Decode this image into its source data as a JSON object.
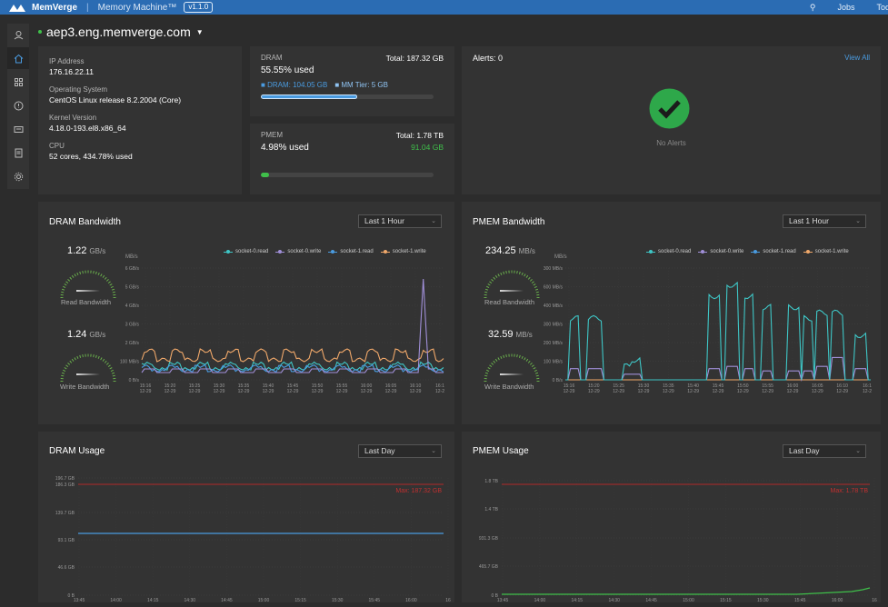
{
  "topbar": {
    "brand": "MemVerge",
    "product": "Memory Machine™",
    "version": "v1.1.0",
    "jobs": "Jobs",
    "tools": "Tool"
  },
  "host": {
    "name": "aep3.eng.memverge.com"
  },
  "sysinfo": [
    {
      "label": "IP Address",
      "value": "176.16.22.11"
    },
    {
      "label": "Operating System",
      "value": "CentOS Linux release 8.2.2004 (Core)"
    },
    {
      "label": "Kernel Version",
      "value": "4.18.0-193.el8.x86_64"
    },
    {
      "label": "CPU",
      "value": "52 cores, 434.78% used"
    }
  ],
  "dram": {
    "label": "DRAM",
    "total": "Total: 187.32 GB",
    "used": "55.55% used",
    "dram_chip": "DRAM: 104.05 GB",
    "mm_tier": "MM Tier: 5 GB",
    "fill_pct": 55.55
  },
  "pmem": {
    "label": "PMEM",
    "total": "Total: 1.78 TB",
    "used": "4.98% used",
    "amount": "91.04 GB",
    "fill_pct": 4.98
  },
  "alerts": {
    "title": "Alerts: 0",
    "view_all": "View All",
    "empty": "No Alerts"
  },
  "dram_bw": {
    "title": "DRAM Bandwidth",
    "range": "Last 1 Hour",
    "read_value": "1.22",
    "read_unit": "GB/s",
    "read_label": "Read Bandwidth",
    "write_value": "1.24",
    "write_unit": "GB/s",
    "write_label": "Write Bandwidth",
    "y_unit": "MB/s",
    "y_ticks": [
      "6 GB/s",
      "5 GB/s",
      "4 GB/s",
      "3 GB/s",
      "2 GB/s",
      "100 MB/s",
      "0 B/s"
    ]
  },
  "pmem_bw": {
    "title": "PMEM Bandwidth",
    "range": "Last 1 Hour",
    "read_value": "234.25",
    "read_unit": "MB/s",
    "read_label": "Read Bandwidth",
    "write_value": "32.59",
    "write_unit": "MB/s",
    "write_label": "Write Bandwidth",
    "y_unit": "MB/s",
    "y_ticks": [
      "300 MB/s",
      "600 MB/s",
      "400 MB/s",
      "300 MB/s",
      "200 MB/s",
      "100 MB/s",
      "0 B/s"
    ]
  },
  "legend": [
    {
      "name": "socket-0.read",
      "color": "#3ec6c6"
    },
    {
      "name": "socket-0.write",
      "color": "#a08fd8"
    },
    {
      "name": "socket-1.read",
      "color": "#4a9be0"
    },
    {
      "name": "socket-1.write",
      "color": "#f0a86a"
    }
  ],
  "bw_xticks": [
    "15:16\n12-29",
    "15:20\n12-29",
    "15:25\n12-29",
    "15:30\n12-29",
    "15:35\n12-29",
    "15:40\n12-29",
    "15:45\n12-29",
    "15:50\n12-29",
    "15:55\n12-29",
    "16:00\n12-29",
    "16:05\n12-29",
    "16:10\n12-29",
    "16:1\n12-2"
  ],
  "dram_usage": {
    "title": "DRAM Usage",
    "range": "Last Day",
    "max_label": "Max: 187.32 GB",
    "y_ticks": [
      "196.7 GB",
      "186.3 GB",
      "139.7 GB",
      "93.1 GB",
      "46.6 GB",
      "0 B"
    ]
  },
  "pmem_usage": {
    "title": "PMEM Usage",
    "range": "Last Day",
    "max_label": "Max: 1.78 TB",
    "y_ticks": [
      "1.8 TB",
      "1.4 TB",
      "931.3 GB",
      "465.7 GB",
      "0 B"
    ]
  },
  "usage_xticks": [
    "13:45",
    "14:00",
    "14:15",
    "14:30",
    "14:45",
    "15:00",
    "15:15",
    "15:30",
    "15:45",
    "16:00",
    "16"
  ],
  "chart_data": [
    {
      "type": "line",
      "title": "DRAM Bandwidth",
      "ylabel": "MB/s",
      "x": [
        "15:16",
        "15:20",
        "15:25",
        "15:30",
        "15:35",
        "15:40",
        "15:45",
        "15:50",
        "15:55",
        "16:00",
        "16:05",
        "16:10",
        "16:15"
      ],
      "series": [
        {
          "name": "socket-0.read",
          "values": [
            0.4,
            0.5,
            0.45,
            0.6,
            0.4,
            0.55,
            0.4,
            0.5,
            0.45,
            0.5,
            0.4,
            0.45,
            0.35
          ]
        },
        {
          "name": "socket-0.write",
          "values": [
            0.3,
            0.35,
            0.3,
            0.4,
            0.3,
            0.45,
            0.3,
            0.35,
            0.3,
            0.4,
            0.3,
            5.5,
            0.3
          ]
        },
        {
          "name": "socket-1.read",
          "values": [
            0.35,
            0.4,
            0.35,
            0.45,
            0.35,
            0.4,
            0.35,
            0.4,
            0.35,
            0.45,
            0.35,
            0.4,
            0.3
          ]
        },
        {
          "name": "socket-1.write",
          "values": [
            0.9,
            0.95,
            0.9,
            1.0,
            0.9,
            0.95,
            0.9,
            1.0,
            0.9,
            0.95,
            0.9,
            1.0,
            0.9
          ]
        }
      ]
    },
    {
      "type": "line",
      "title": "PMEM Bandwidth",
      "ylabel": "MB/s",
      "x": [
        "15:16",
        "15:20",
        "15:25",
        "15:30",
        "15:35",
        "15:40",
        "15:45",
        "15:50",
        "15:55",
        "16:00",
        "16:05",
        "16:10",
        "16:15"
      ],
      "series": [
        {
          "name": "socket-0.read",
          "values": [
            200,
            270,
            0,
            60,
            0,
            0,
            370,
            380,
            350,
            270,
            290,
            250,
            160
          ]
        },
        {
          "name": "socket-0.write",
          "values": [
            40,
            40,
            0,
            20,
            0,
            0,
            50,
            60,
            40,
            30,
            40,
            90,
            40
          ]
        }
      ]
    },
    {
      "type": "line",
      "title": "DRAM Usage",
      "series": [
        {
          "name": "used",
          "values": [
            104,
            104,
            104,
            104,
            104,
            104,
            104,
            104,
            104,
            104
          ]
        }
      ],
      "max": "187.32 GB"
    },
    {
      "type": "line",
      "title": "PMEM Usage",
      "series": [
        {
          "name": "used",
          "values": [
            0.02,
            0.02,
            0.02,
            0.02,
            0.02,
            0.02,
            0.02,
            0.02,
            0.04,
            0.09
          ]
        }
      ],
      "max": "1.78 TB"
    }
  ]
}
